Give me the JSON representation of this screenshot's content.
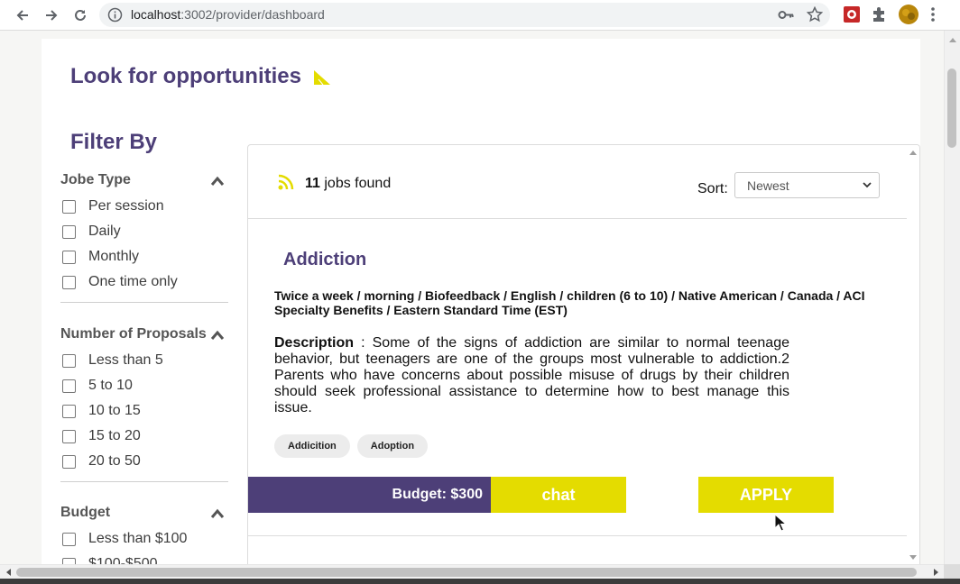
{
  "browser": {
    "url_host": "localhost",
    "url_path": ":3002/provider/dashboard"
  },
  "page": {
    "title": "Look for opportunities",
    "filter_title": "Filter By"
  },
  "filters": {
    "job_type": {
      "title": "Jobe Type",
      "options": [
        "Per session",
        "Daily",
        "Monthly",
        "One time only"
      ]
    },
    "proposals": {
      "title": "Number of Proposals",
      "options": [
        "Less than 5",
        "5 to 10",
        "10 to 15",
        "15 to 20",
        "20 to 50"
      ]
    },
    "budget": {
      "title": "Budget",
      "options": [
        "Less than $100",
        "$100-$500"
      ]
    }
  },
  "results": {
    "count": "11",
    "count_suffix": "jobs found",
    "sort_label": "Sort:",
    "sort_value": "Newest"
  },
  "job": {
    "title": "Addiction",
    "meta": "Twice a week / morning / Biofeedback / English / children (6 to 10) / Native American / Canada / ACI Specialty Benefits / Eastern Standard Time (EST)",
    "description_label": "Description",
    "description": " : Some of the signs of addiction are similar to normal teenage behavior, but teenagers are one of the groups most vulnerable to addiction.2 Parents who have concerns about possible misuse of drugs by their children should seek professional assistance to determine how to best manage this issue.",
    "tags": [
      "Addicition",
      "Adoption"
    ],
    "budget": "Budget: $300",
    "chat_label": "chat",
    "apply_label": "APPLY"
  },
  "colors": {
    "brand_purple": "#4d3f78",
    "accent_yellow": "#e4dc00"
  }
}
